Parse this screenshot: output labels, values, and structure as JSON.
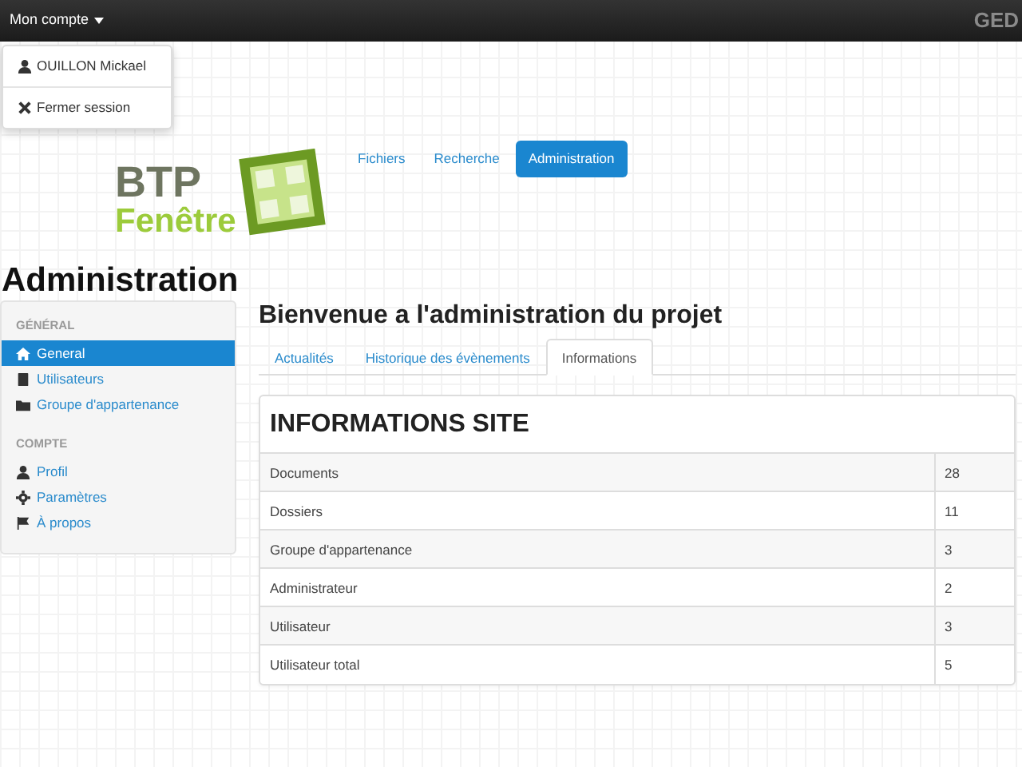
{
  "navbar": {
    "account_menu": "Mon compte",
    "brand": "GED"
  },
  "account_dropdown": [
    "OUILLON Mickael",
    "Fermer session"
  ],
  "logo": {
    "line_1": "BTP",
    "line_2": "Fenêtre"
  },
  "nav_pills": [
    {
      "label": "Fichiers",
      "selected": false
    },
    {
      "label": "Recherche",
      "selected": false
    },
    {
      "label": "Administration",
      "selected": true
    }
  ],
  "page_title": "Administration",
  "sidebar": [
    {
      "header": "GÉNÉRAL",
      "items": [
        {
          "label": "General",
          "selected": true
        },
        {
          "label": "Utilisateurs",
          "selected": false
        },
        {
          "label": "Groupe d'appartenance",
          "selected": false
        }
      ]
    },
    {
      "header": "COMPTE",
      "items": [
        {
          "label": "Profil",
          "selected": false
        },
        {
          "label": "Paramètres",
          "selected": false
        },
        {
          "label": "À propos",
          "selected": false
        }
      ]
    }
  ],
  "main": {
    "heading": "Bienvenue a l'administration du projet",
    "tabs": [
      {
        "label": "Actualités",
        "selected": false
      },
      {
        "label": "Historique des évènements",
        "selected": false
      },
      {
        "label": "Informations",
        "selected": true
      }
    ],
    "panel_title": "INFORMATIONS SITE",
    "rows": [
      [
        "Documents",
        "28"
      ],
      [
        "Dossiers",
        "11"
      ],
      [
        "Groupe d'appartenance",
        "3"
      ],
      [
        "Administrateur",
        "2"
      ],
      [
        "Utilisateur",
        "3"
      ],
      [
        "Utilisateur total",
        "5"
      ]
    ]
  }
}
